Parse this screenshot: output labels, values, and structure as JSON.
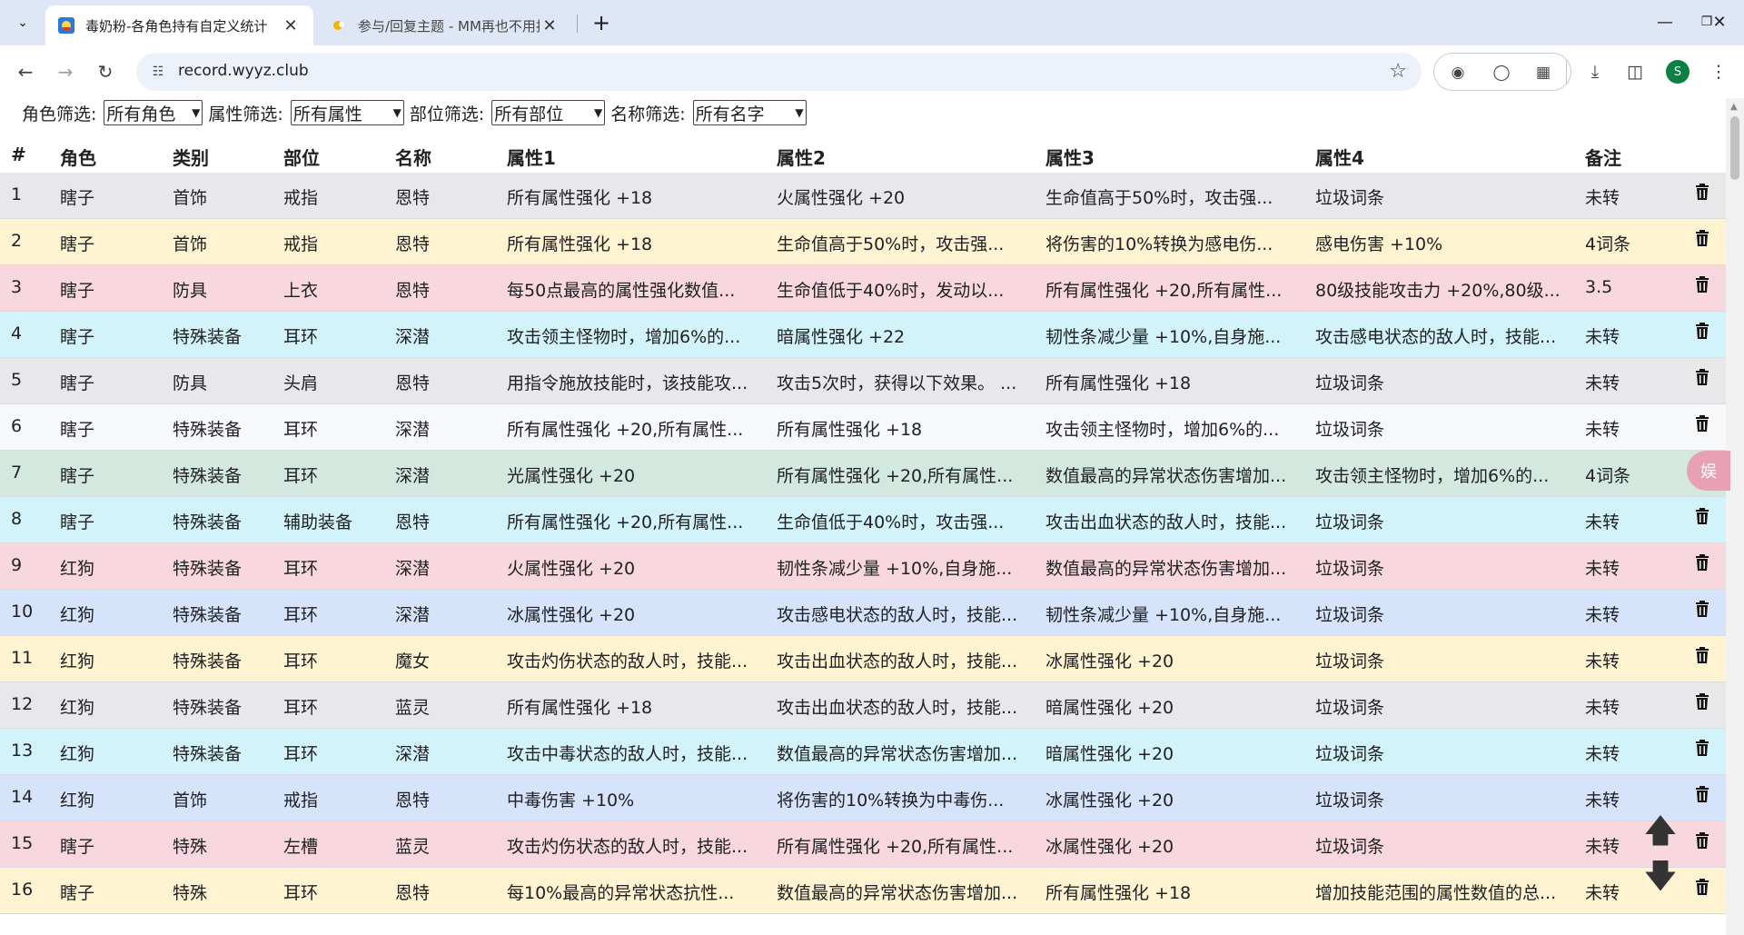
{
  "browser": {
    "tabs": [
      {
        "title": "毒奶粉-各角色持有自定义统计",
        "active": true
      },
      {
        "title": "参与/回复主题 - MM再也不用担心",
        "active": false
      }
    ],
    "url": "record.wyyz.club",
    "profile_initial": "S"
  },
  "filters": [
    {
      "label": "角色筛选:",
      "value": "所有角色"
    },
    {
      "label": "属性筛选:",
      "value": "所有属性"
    },
    {
      "label": "部位筛选:",
      "value": "所有部位"
    },
    {
      "label": "名称筛选:",
      "value": "所有名字"
    }
  ],
  "table": {
    "headers": [
      "#",
      "角色",
      "类别",
      "部位",
      "名称",
      "属性1",
      "属性2",
      "属性3",
      "属性4",
      "备注"
    ],
    "rows": [
      {
        "id": "1",
        "role": "瞎子",
        "cat": "首饰",
        "part": "戒指",
        "name": "恩特",
        "a1": "所有属性强化 +18",
        "a2": "火属性强化 +20",
        "a3": "生命值高于50%时，攻击强...",
        "a4": "垃圾词条",
        "note": "未转",
        "bg": "#e8e8ea"
      },
      {
        "id": "2",
        "role": "瞎子",
        "cat": "首饰",
        "part": "戒指",
        "name": "恩特",
        "a1": "所有属性强化 +18",
        "a2": "生命值高于50%时，攻击强...",
        "a3": "将伤害的10%转换为感电伤...",
        "a4": "感电伤害 +10%",
        "note": "4词条",
        "bg": "#fff3d1"
      },
      {
        "id": "3",
        "role": "瞎子",
        "cat": "防具",
        "part": "上衣",
        "name": "恩特",
        "a1": "每50点最高的属性强化数值...",
        "a2": "生命值低于40%时，发动以...",
        "a3": "所有属性强化 +20,所有属性...",
        "a4": "80级技能攻击力 +20%,80级...",
        "note": "3.5",
        "bg": "#f9d7de"
      },
      {
        "id": "4",
        "role": "瞎子",
        "cat": "特殊装备",
        "part": "耳环",
        "name": "深潜",
        "a1": "攻击领主怪物时，增加6%的...",
        "a2": "暗属性强化 +22",
        "a3": "韧性条减少量 +10%,自身施...",
        "a4": "攻击感电状态的敌人时，技能...",
        "note": "未转",
        "bg": "#d2f3f9"
      },
      {
        "id": "5",
        "role": "瞎子",
        "cat": "防具",
        "part": "头肩",
        "name": "恩特",
        "a1": "用指令施放技能时，该技能攻...",
        "a2": "攻击5次时，获得以下效果。 ...",
        "a3": "所有属性强化 +18",
        "a4": "垃圾词条",
        "note": "未转",
        "bg": "#e8e8ea"
      },
      {
        "id": "6",
        "role": "瞎子",
        "cat": "特殊装备",
        "part": "耳环",
        "name": "深潜",
        "a1": "所有属性强化 +20,所有属性...",
        "a2": "所有属性强化 +18",
        "a3": "攻击领主怪物时，增加6%的...",
        "a4": "垃圾词条",
        "note": "未转",
        "bg": "#f7f8fa"
      },
      {
        "id": "7",
        "role": "瞎子",
        "cat": "特殊装备",
        "part": "耳环",
        "name": "深潜",
        "a1": "光属性强化 +20",
        "a2": "所有属性强化 +20,所有属性...",
        "a3": "数值最高的异常状态伤害增加...",
        "a4": "攻击领主怪物时，增加6%的...",
        "note": "4词条",
        "bg": "#d3e9df"
      },
      {
        "id": "8",
        "role": "瞎子",
        "cat": "特殊装备",
        "part": "辅助装备",
        "name": "恩特",
        "a1": "所有属性强化 +20,所有属性...",
        "a2": "生命值低于40%时，攻击强...",
        "a3": "攻击出血状态的敌人时，技能...",
        "a4": "垃圾词条",
        "note": "未转",
        "bg": "#d2f3f9"
      },
      {
        "id": "9",
        "role": "红狗",
        "cat": "特殊装备",
        "part": "耳环",
        "name": "深潜",
        "a1": "火属性强化 +20",
        "a2": "韧性条减少量 +10%,自身施...",
        "a3": "数值最高的异常状态伤害增加...",
        "a4": "垃圾词条",
        "note": "未转",
        "bg": "#f9d7de"
      },
      {
        "id": "10",
        "role": "红狗",
        "cat": "特殊装备",
        "part": "耳环",
        "name": "深潜",
        "a1": "冰属性强化 +20",
        "a2": "攻击感电状态的敌人时，技能...",
        "a3": "韧性条减少量 +10%,自身施...",
        "a4": "垃圾词条",
        "note": "未转",
        "bg": "#d5e3fb"
      },
      {
        "id": "11",
        "role": "红狗",
        "cat": "特殊装备",
        "part": "耳环",
        "name": "魔女",
        "a1": "攻击灼伤状态的敌人时，技能...",
        "a2": "攻击出血状态的敌人时，技能...",
        "a3": "冰属性强化 +20",
        "a4": "垃圾词条",
        "note": "未转",
        "bg": "#fff3d1"
      },
      {
        "id": "12",
        "role": "红狗",
        "cat": "特殊装备",
        "part": "耳环",
        "name": "蓝灵",
        "a1": "所有属性强化 +18",
        "a2": "攻击出血状态的敌人时，技能...",
        "a3": "暗属性强化 +20",
        "a4": "垃圾词条",
        "note": "未转",
        "bg": "#e8e8ea"
      },
      {
        "id": "13",
        "role": "红狗",
        "cat": "特殊装备",
        "part": "耳环",
        "name": "深潜",
        "a1": "攻击中毒状态的敌人时，技能...",
        "a2": "数值最高的异常状态伤害增加...",
        "a3": "暗属性强化 +20",
        "a4": "垃圾词条",
        "note": "未转",
        "bg": "#d2f3f9"
      },
      {
        "id": "14",
        "role": "红狗",
        "cat": "首饰",
        "part": "戒指",
        "name": "恩特",
        "a1": "中毒伤害 +10%",
        "a2": "将伤害的10%转换为中毒伤...",
        "a3": "冰属性强化 +20",
        "a4": "垃圾词条",
        "note": "未转",
        "bg": "#d5e3fb"
      },
      {
        "id": "15",
        "role": "瞎子",
        "cat": "特殊",
        "part": "左槽",
        "name": "蓝灵",
        "a1": "攻击灼伤状态的敌人时，技能...",
        "a2": "所有属性强化 +20,所有属性...",
        "a3": "冰属性强化 +20",
        "a4": "垃圾词条",
        "note": "未转",
        "bg": "#f9d7de"
      },
      {
        "id": "16",
        "role": "瞎子",
        "cat": "特殊",
        "part": "耳环",
        "name": "恩特",
        "a1": "每10%最高的异常状态抗性...",
        "a2": "数值最高的异常状态伤害增加...",
        "a3": "所有属性强化 +18",
        "a4": "增加技能范围的属性数值的总...",
        "note": "未转",
        "bg": "#fff3d1"
      }
    ]
  },
  "side_badge": "娱",
  "colors": {
    "accent": "#0b57d0",
    "tabbar": "#dfe7f7",
    "omnibox": "#edf1fa"
  }
}
